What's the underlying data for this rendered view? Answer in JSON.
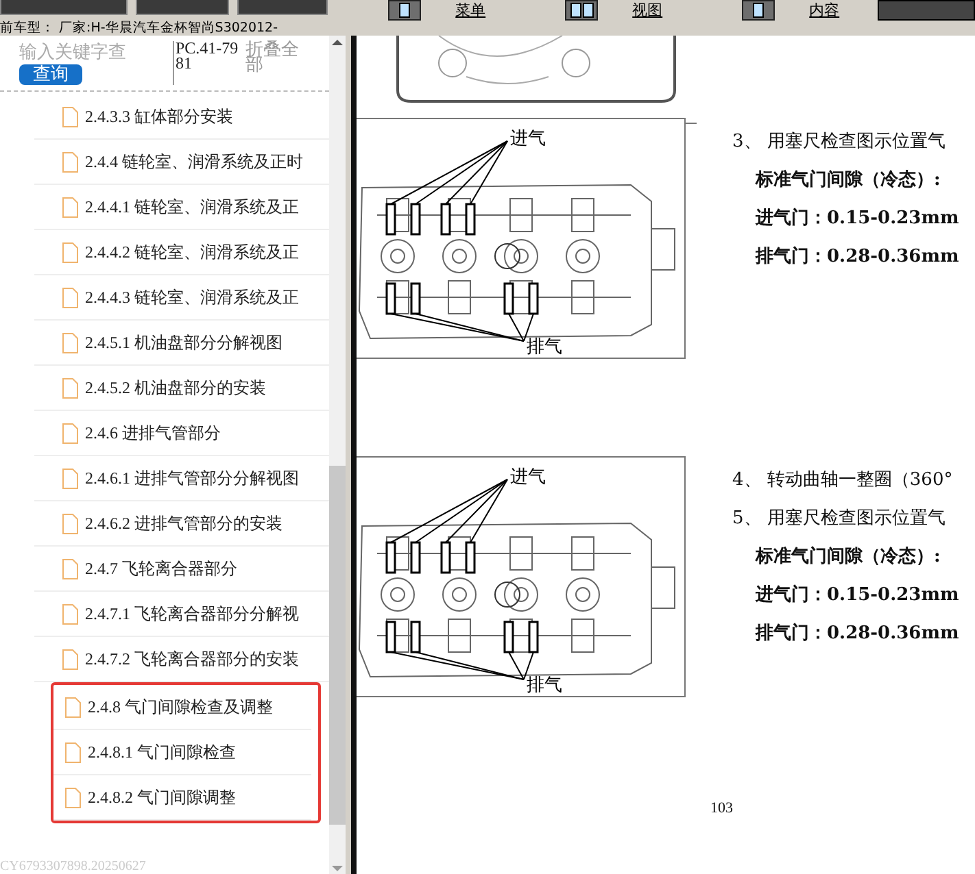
{
  "toolbar": {
    "buttons": [
      {
        "label": "菜单",
        "kind": "single"
      },
      {
        "label": "视图",
        "kind": "split"
      },
      {
        "label": "内容",
        "kind": "single"
      }
    ]
  },
  "vehicle_line": "前车型： 厂家:H-华晨汽车金杯智尚S302012-",
  "sidebar": {
    "search": {
      "placeholder": "输入关键字查"
    },
    "query_button": "查询",
    "code": "PC.41-7981",
    "collapse_button": "折叠全部",
    "items": [
      {
        "label": "2.4.3.3 缸体部分安装",
        "marked": false
      },
      {
        "label": "2.4.4 链轮室、润滑系统及正时",
        "marked": false
      },
      {
        "label": "2.4.4.1 链轮室、润滑系统及正",
        "marked": false
      },
      {
        "label": "2.4.4.2 链轮室、润滑系统及正",
        "marked": false
      },
      {
        "label": "2.4.4.3 链轮室、润滑系统及正",
        "marked": false
      },
      {
        "label": "2.4.5.1 机油盘部分分解视图",
        "marked": false
      },
      {
        "label": "2.4.5.2 机油盘部分的安装",
        "marked": false
      },
      {
        "label": "2.4.6 进排气管部分",
        "marked": false
      },
      {
        "label": "2.4.6.1 进排气管部分分解视图",
        "marked": false
      },
      {
        "label": "2.4.6.2 进排气管部分的安装",
        "marked": false
      },
      {
        "label": "2.4.7 飞轮离合器部分",
        "marked": false
      },
      {
        "label": "2.4.7.1 飞轮离合器部分分解视",
        "marked": false
      },
      {
        "label": "2.4.7.2 飞轮离合器部分的安装",
        "marked": false
      },
      {
        "label": "2.4.8 气门间隙检查及调整",
        "marked": true
      },
      {
        "label": "2.4.8.1 气门间隙检查",
        "marked": true
      },
      {
        "label": "2.4.8.2 气门间隙调整",
        "marked": true
      }
    ],
    "footer": "CY6793307898.20250627"
  },
  "document": {
    "sections": [
      {
        "figure": {
          "intake_label": "进气",
          "exhaust_label": "排气"
        },
        "lines": [
          {
            "text": "3、 用塞尺检查图示位置气",
            "kind": "step"
          },
          {
            "text": "标准气门间隙（冷态）:",
            "kind": "bold"
          },
          {
            "text": "进气门：0.15-0.23mm",
            "kind": "bold"
          },
          {
            "text": "排气门：0.28-0.36mm",
            "kind": "bold"
          }
        ]
      },
      {
        "figure": {
          "intake_label": "进气",
          "exhaust_label": "排气"
        },
        "lines": [
          {
            "text": "4、 转动曲轴一整圈（360°",
            "kind": "step"
          },
          {
            "text": "5、 用塞尺检查图示位置气",
            "kind": "step"
          },
          {
            "text": "标准气门间隙（冷态）:",
            "kind": "bold"
          },
          {
            "text": "进气门：0.15-0.23mm",
            "kind": "bold"
          },
          {
            "text": "排气门：0.28-0.36mm",
            "kind": "bold"
          }
        ]
      }
    ],
    "page_number": "103"
  }
}
